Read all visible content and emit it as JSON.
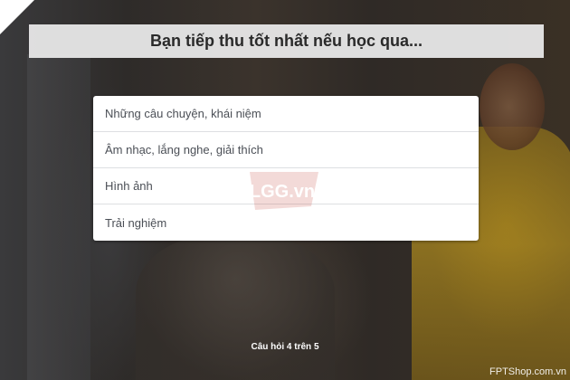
{
  "quiz": {
    "question": "Bạn tiếp thu tốt nhất nếu học qua...",
    "options": [
      {
        "label": "Những câu chuyện, khái niệm"
      },
      {
        "label": "Âm nhạc, lắng nghe, giải thích"
      },
      {
        "label": "Hình ảnh"
      },
      {
        "label": "Trải nghiệm"
      }
    ],
    "progress_text": "Câu hỏi 4 trên 5"
  },
  "watermark": {
    "text": "LGG.vn",
    "color": "#c0392b"
  },
  "brand": {
    "text": "FPTShop.com.vn"
  },
  "colors": {
    "option_text": "#4b4f56",
    "title_bar_bg": "#e8e8e8",
    "coat": "#a8861f"
  }
}
